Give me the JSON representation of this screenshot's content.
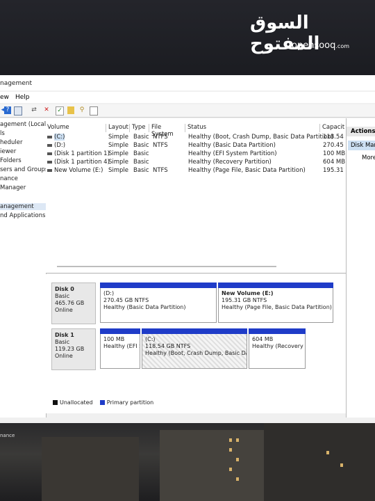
{
  "watermark": {
    "arabic": "السوق المفتوح",
    "site": "opensooq",
    "tld": ".com"
  },
  "window": {
    "title": "nagement"
  },
  "menu": {
    "view": "ew",
    "help": "Help"
  },
  "toolbar": {
    "icons": [
      "back-icon",
      "properties-icon",
      "help-icon",
      "view-icon",
      "connect-icon",
      "delete-icon",
      "check-icon",
      "folder-icon",
      "search-icon",
      "list-icon"
    ]
  },
  "tree": {
    "items": [
      "agement (Local",
      "ls",
      "heduler",
      "iewer",
      "Folders",
      "sers and Groups",
      "nance",
      "Manager",
      "anagement",
      "nd Applications"
    ]
  },
  "volumes": {
    "columns": [
      "Volume",
      "Layout",
      "Type",
      "File System",
      "Status",
      "Capacit"
    ],
    "rows": [
      {
        "volume": "(C:)",
        "layout": "Simple",
        "type": "Basic",
        "fs": "NTFS",
        "status": "Healthy (Boot, Crash Dump, Basic Data Partition)",
        "capacity": "118.54 C"
      },
      {
        "volume": "(D:)",
        "layout": "Simple",
        "type": "Basic",
        "fs": "NTFS",
        "status": "Healthy (Basic Data Partition)",
        "capacity": "270.45 C"
      },
      {
        "volume": "(Disk 1 partition 1)",
        "layout": "Simple",
        "type": "Basic",
        "fs": "",
        "status": "Healthy (EFI System Partition)",
        "capacity": "100 MB"
      },
      {
        "volume": "(Disk 1 partition 4)",
        "layout": "Simple",
        "type": "Basic",
        "fs": "",
        "status": "Healthy (Recovery Partition)",
        "capacity": "604 MB"
      },
      {
        "volume": "New Volume (E:)",
        "layout": "Simple",
        "type": "Basic",
        "fs": "NTFS",
        "status": "Healthy (Page File, Basic Data Partition)",
        "capacity": "195.31 C"
      }
    ]
  },
  "actions": {
    "header": "Actions",
    "selected": "Disk Man",
    "more": "More"
  },
  "disks": [
    {
      "name": "Disk 0",
      "type": "Basic",
      "size": "465.76 GB",
      "state": "Online",
      "partitions": [
        {
          "label": "(D:)",
          "size": "270.45 GB NTFS",
          "status": "Healthy (Basic Data Partition)"
        },
        {
          "label": "New Volume  (E:)",
          "size": "195.31 GB NTFS",
          "status": "Healthy (Page File, Basic Data Partition)"
        }
      ]
    },
    {
      "name": "Disk 1",
      "type": "Basic",
      "size": "119.23 GB",
      "state": "Online",
      "partitions": [
        {
          "label": "",
          "size": "100 MB",
          "status": "Healthy (EFI S"
        },
        {
          "label": "(C:)",
          "size": "118.54 GB NTFS",
          "status": "Healthy (Boot, Crash Dump, Basic Data"
        },
        {
          "label": "",
          "size": "604 MB",
          "status": "Healthy (Recovery P."
        }
      ]
    }
  ],
  "legend": {
    "unallocated": "Unallocated",
    "primary": "Primary partition",
    "unallocated_color": "#111111",
    "primary_color": "#1f3cc8"
  },
  "desktop": {
    "taskbar_text": "nance"
  }
}
